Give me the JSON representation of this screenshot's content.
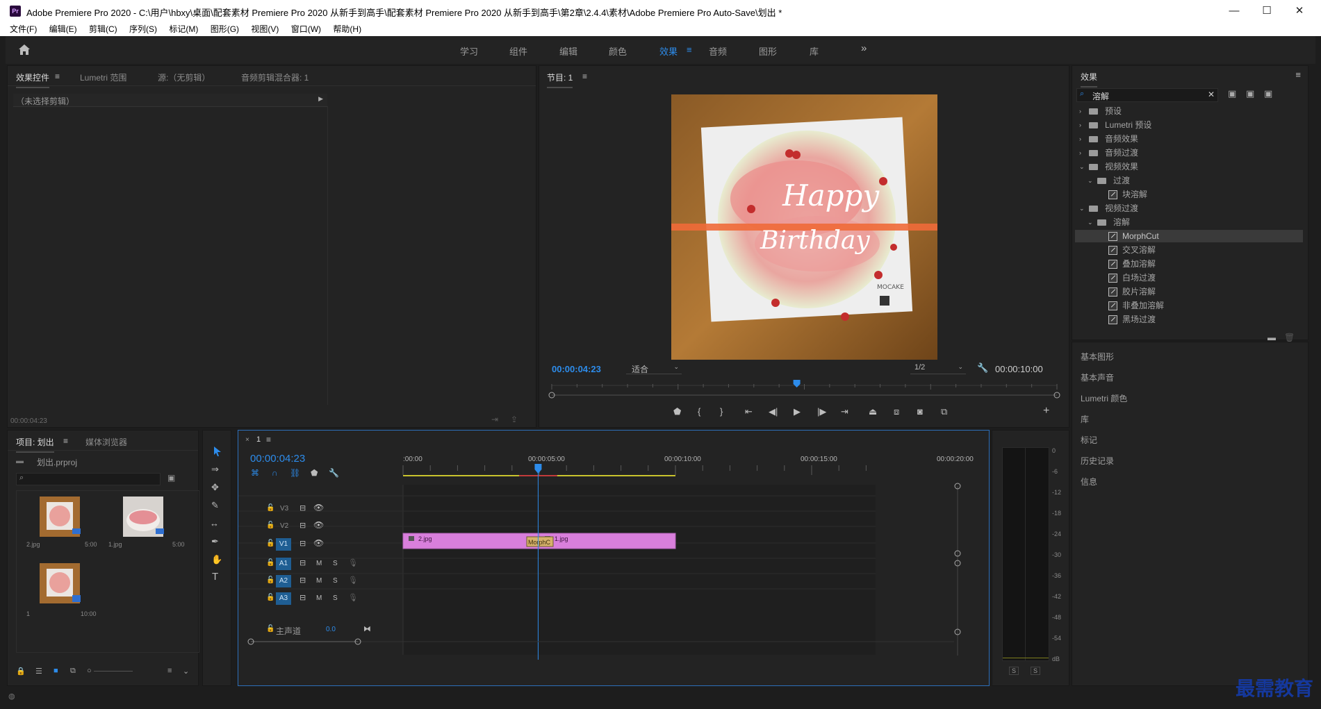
{
  "window": {
    "title": "Adobe Premiere Pro 2020 - C:\\用户\\hbxy\\桌面\\配套素材 Premiere Pro 2020 从新手到高手\\配套素材 Premiere Pro 2020 从新手到高手\\第2章\\2.4.4\\素材\\Adobe Premiere Pro Auto-Save\\划出 *",
    "app_icon": "Pr",
    "minimize": "—",
    "maximize": "☐",
    "close": "✕"
  },
  "menu": [
    "文件(F)",
    "编辑(E)",
    "剪辑(C)",
    "序列(S)",
    "标记(M)",
    "图形(G)",
    "视图(V)",
    "窗口(W)",
    "帮助(H)"
  ],
  "workspaces": {
    "tabs": [
      "学习",
      "组件",
      "编辑",
      "颜色",
      "效果",
      "音频",
      "图形",
      "库"
    ],
    "active": "效果",
    "more": "»"
  },
  "source_panel": {
    "tabs": [
      "效果控件",
      "Lumetri 范围",
      "源:（无剪辑）",
      "音频剪辑混合器: 1"
    ],
    "clip_selector": "（未选择剪辑）",
    "timecode": "00:00:04:23"
  },
  "program_monitor": {
    "tab": "节目: 1",
    "timecode": "00:00:04:23",
    "fit": "适合",
    "resolution": "1/2",
    "duration": "00:00:10:00",
    "playhead_fraction": 0.485,
    "video_texts": [
      "Happy",
      "Birthday",
      "MOCAKE"
    ]
  },
  "effects_panel": {
    "title": "效果",
    "search_value": "溶解",
    "tree": [
      {
        "label": "预设",
        "type": "folder",
        "level": 0,
        "expanded": false
      },
      {
        "label": "Lumetri 预设",
        "type": "folder",
        "level": 0,
        "expanded": false
      },
      {
        "label": "音频效果",
        "type": "folder",
        "level": 0,
        "expanded": false
      },
      {
        "label": "音频过渡",
        "type": "folder",
        "level": 0,
        "expanded": false
      },
      {
        "label": "视频效果",
        "type": "folder",
        "level": 0,
        "expanded": true
      },
      {
        "label": "过渡",
        "type": "folder",
        "level": 1,
        "expanded": true
      },
      {
        "label": "块溶解",
        "type": "effect",
        "level": 2
      },
      {
        "label": "视频过渡",
        "type": "folder",
        "level": 0,
        "expanded": true
      },
      {
        "label": "溶解",
        "type": "folder",
        "level": 1,
        "expanded": true
      },
      {
        "label": "MorphCut",
        "type": "effect",
        "level": 2,
        "selected": true
      },
      {
        "label": "交叉溶解",
        "type": "effect",
        "level": 2
      },
      {
        "label": "叠加溶解",
        "type": "effect",
        "level": 2
      },
      {
        "label": "白场过渡",
        "type": "effect",
        "level": 2
      },
      {
        "label": "胶片溶解",
        "type": "effect",
        "level": 2
      },
      {
        "label": "非叠加溶解",
        "type": "effect",
        "level": 2
      },
      {
        "label": "黑场过渡",
        "type": "effect",
        "level": 2
      }
    ]
  },
  "side_panels": [
    "基本图形",
    "基本声音",
    "Lumetri 颜色",
    "库",
    "标记",
    "历史记录",
    "信息"
  ],
  "project_panel": {
    "tabs": [
      "项目: 划出",
      "媒体浏览器"
    ],
    "project_file": "划出.prproj",
    "items": [
      {
        "name": "2.jpg",
        "duration": "5:00"
      },
      {
        "name": "1.jpg",
        "duration": "5:00"
      },
      {
        "name": "1",
        "duration": "10:00"
      }
    ]
  },
  "timeline": {
    "sequence": "1",
    "timecode": "00:00:04:23",
    "ruler": [
      ":00:00",
      "00:00:05:00",
      "00:00:10:00",
      "00:00:15:00",
      "00:00:20:00"
    ],
    "video_tracks": [
      "V3",
      "V2",
      "V1"
    ],
    "audio_tracks": [
      "A1",
      "A2",
      "A3"
    ],
    "master": {
      "label": "主声道",
      "value": "0.0"
    },
    "clips": [
      {
        "name": "2.jpg",
        "start": 0,
        "end": 5
      },
      {
        "name": "1.jpg",
        "start": 5,
        "end": 10
      }
    ],
    "transition": "MorphC",
    "playhead_seconds": 4.96
  },
  "audio_meter": {
    "scale": [
      "0",
      "-6",
      "-12",
      "-18",
      "-24",
      "-30",
      "-36",
      "-42",
      "-48",
      "-54",
      "dB"
    ],
    "solo_labels": [
      "S",
      "S"
    ]
  },
  "watermark": "最需教育"
}
